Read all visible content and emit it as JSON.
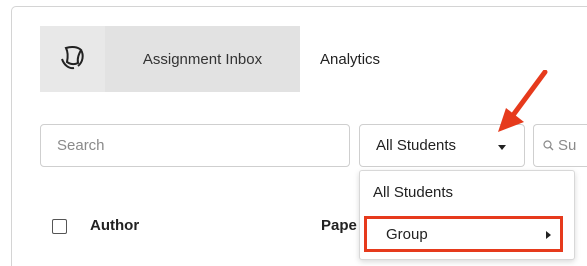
{
  "nav": {
    "logo_icon": "turnitin-logo-icon",
    "tabs": [
      {
        "label": "Assignment Inbox",
        "active": true
      },
      {
        "label": "Analytics",
        "active": false
      }
    ]
  },
  "toolbar": {
    "search_placeholder": "Search",
    "student_filter": {
      "selected": "All Students",
      "icon": "chevron-down-icon"
    },
    "search2_placeholder": "Su",
    "search2_icon": "search-icon"
  },
  "table": {
    "columns": [
      "Author",
      "Pape"
    ]
  },
  "dropdown_menu": {
    "items": [
      {
        "label": "All Students",
        "has_submenu": false
      },
      {
        "label": "Group",
        "has_submenu": true,
        "highlighted": true
      }
    ]
  },
  "colors": {
    "annotation": "#e63a1c",
    "nav_active_bg": "#e2e2e2"
  }
}
